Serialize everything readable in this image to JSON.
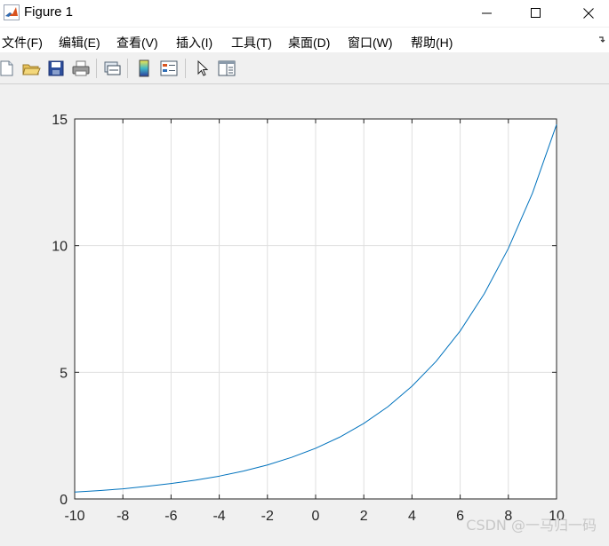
{
  "window": {
    "title": "Figure 1",
    "controls": [
      "minimize",
      "maximize",
      "close"
    ]
  },
  "menu": {
    "items": [
      "文件(F)",
      "编辑(E)",
      "查看(V)",
      "插入(I)",
      "工具(T)",
      "桌面(D)",
      "窗口(W)",
      "帮助(H)"
    ]
  },
  "toolbar": {
    "buttons": [
      {
        "icon": "new-figure-icon"
      },
      {
        "icon": "open-file-icon"
      },
      {
        "icon": "save-icon"
      },
      {
        "icon": "print-icon"
      },
      {
        "icon": "link-plot-icon"
      },
      {
        "icon": "insert-colorbar-icon"
      },
      {
        "icon": "insert-legend-icon"
      },
      {
        "icon": "pointer-arrow-icon"
      },
      {
        "icon": "property-editor-icon"
      }
    ]
  },
  "chart_data": {
    "type": "line",
    "title": "",
    "xlabel": "",
    "ylabel": "",
    "xlim": [
      -10,
      10
    ],
    "ylim": [
      0,
      15
    ],
    "xticks": [
      -10,
      -8,
      -6,
      -4,
      -2,
      0,
      2,
      4,
      6,
      8,
      10
    ],
    "yticks": [
      0,
      5,
      10,
      15
    ],
    "grid": true,
    "series": [
      {
        "color": "#0072bd",
        "x": [
          -10,
          -9,
          -8,
          -7,
          -6,
          -5,
          -4,
          -3,
          -2,
          -1,
          0,
          1,
          2,
          3,
          4,
          5,
          6,
          7,
          8,
          9,
          10
        ],
        "y": [
          0.27,
          0.33,
          0.4,
          0.5,
          0.61,
          0.74,
          0.9,
          1.1,
          1.34,
          1.64,
          2.0,
          2.44,
          2.98,
          3.64,
          4.45,
          5.43,
          6.63,
          8.1,
          9.89,
          12.07,
          14.78
        ]
      }
    ]
  },
  "watermark": "CSDN @一马归一码"
}
